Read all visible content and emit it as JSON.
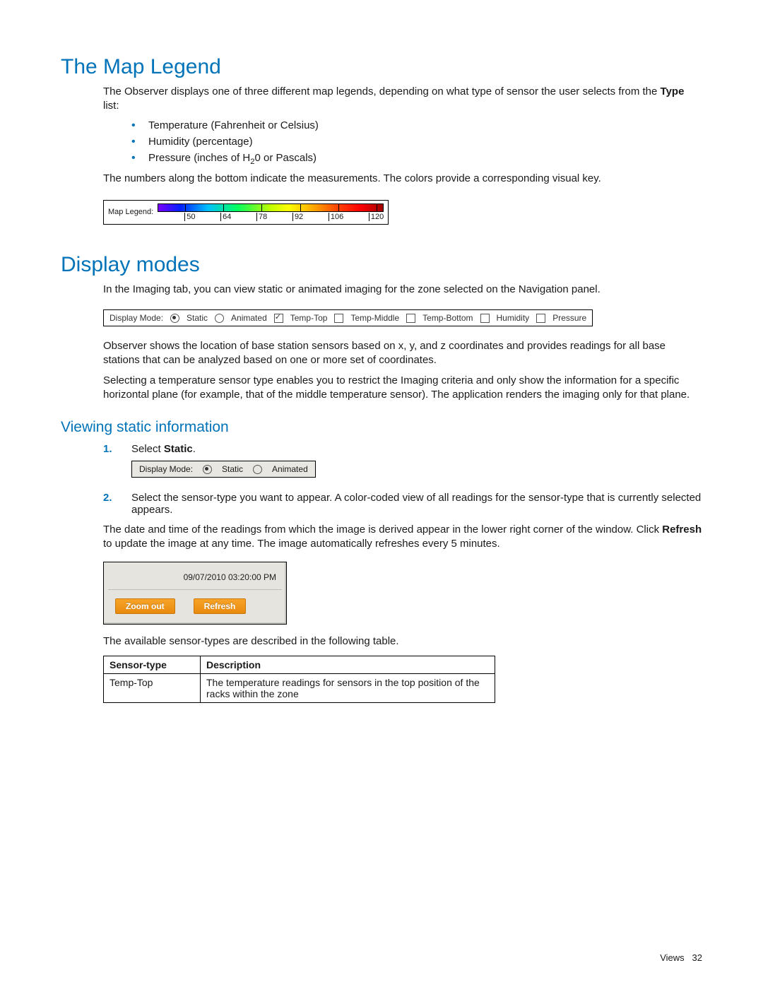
{
  "mapLegend": {
    "heading": "The Map Legend",
    "intro_a": "The Observer displays one of three different map legends, depending on what type of sensor the user selects from the ",
    "intro_bold": "Type",
    "intro_b": " list:",
    "bullets": [
      "Temperature (Fahrenheit or Celsius)",
      "Humidity (percentage)"
    ],
    "bullet3_a": "Pressure (inches of H",
    "bullet3_sub": "2",
    "bullet3_b": "0 or Pascals)",
    "after": "The numbers along the bottom indicate the measurements. The colors provide a corresponding visual key.",
    "fig": {
      "label": "Map Legend:",
      "ticks": [
        "50",
        "64",
        "78",
        "92",
        "106",
        "120"
      ]
    }
  },
  "displayModes": {
    "heading": "Display modes",
    "intro": "In the Imaging tab, you can view static or animated imaging for the zone selected on the Navigation panel.",
    "bar": {
      "label": "Display Mode:",
      "static": "Static",
      "animated": "Animated",
      "opts": [
        "Temp-Top",
        "Temp-Middle",
        "Temp-Bottom",
        "Humidity",
        "Pressure"
      ]
    },
    "p2": "Observer shows the location of base station sensors based on x, y, and z coordinates and provides readings for all base stations that can be analyzed based on one or more set of coordinates.",
    "p3": "Selecting a temperature sensor type enables you to restrict the Imaging criteria and only show the information for a specific horizontal plane (for example, that of the middle temperature sensor). The application renders the imaging only for that plane."
  },
  "viewingStatic": {
    "heading": "Viewing static information",
    "step1_a": "Select ",
    "step1_bold": "Static",
    "step1_b": ".",
    "smallBar": {
      "label": "Display Mode:",
      "static": "Static",
      "animated": "Animated"
    },
    "step2": "Select the sensor-type you want to appear. A color-coded view of all readings for the sensor-type that is currently selected appears.",
    "p_after_a": "The date and time of the readings from which the image is derived appear in the lower right corner of the window. Click ",
    "p_after_bold": "Refresh",
    "p_after_b": " to update the image at any time. The image automatically refreshes every 5 minutes.",
    "panel": {
      "timestamp": "09/07/2010 03:20:00 PM",
      "zoomOut": "Zoom out",
      "refresh": "Refresh"
    },
    "tableIntro": "The available sensor-types are described in the following table.",
    "table": {
      "h1": "Sensor-type",
      "h2": "Description",
      "r1c1": "Temp-Top",
      "r1c2": "The temperature readings for sensors in the top position of the racks within the zone"
    }
  },
  "footer": {
    "section": "Views",
    "page": "32"
  }
}
